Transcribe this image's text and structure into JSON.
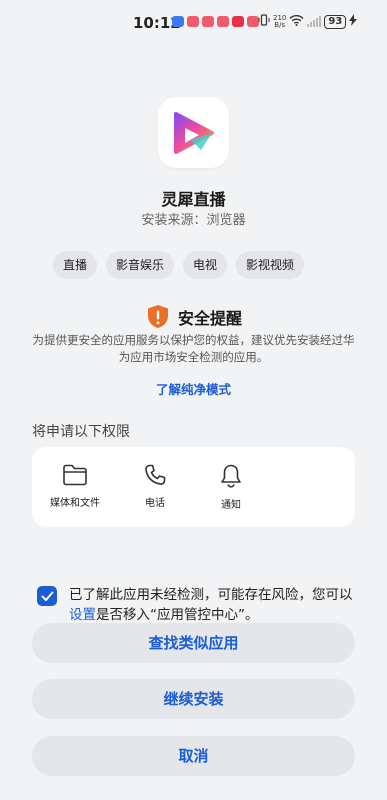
{
  "status_bar": {
    "time": "10:12",
    "net_speed_value": "210",
    "net_speed_unit": "B/s",
    "battery": "93",
    "icons": [
      "app-notification-icon",
      "vibrate-icon",
      "wifi-icon",
      "signal-icon",
      "charging-icon"
    ]
  },
  "app": {
    "name": "灵犀直播",
    "source": "安装来源：浏览器",
    "tags": [
      "直播",
      "影音娱乐",
      "电视",
      "影视视频"
    ]
  },
  "safety": {
    "title": "安全提醒",
    "description": "为提供更安全的应用服务以保护您的权益，建议优先安装经过华为应用市场安全检测的应用。",
    "link": "了解纯净模式",
    "icon": "shield-alert-icon",
    "icon_color": "#e8702a"
  },
  "permissions": {
    "title": "将申请以下权限",
    "items": [
      {
        "label": "媒体和文件",
        "icon": "folder-icon"
      },
      {
        "label": "电话",
        "icon": "phone-icon"
      },
      {
        "label": "通知",
        "icon": "bell-icon"
      }
    ]
  },
  "agreement": {
    "checked": true,
    "text_before": "已了解此应用未经检测，可能存在风险，您可以",
    "link": "设置",
    "text_after": "是否移入“应用管控中心”。"
  },
  "buttons": {
    "find_similar": "查找类似应用",
    "continue_install": "继续安装",
    "cancel": "取消"
  },
  "colors": {
    "accent": "#1a5dd6",
    "background": "#f1f3f5",
    "warning": "#e8702a"
  }
}
